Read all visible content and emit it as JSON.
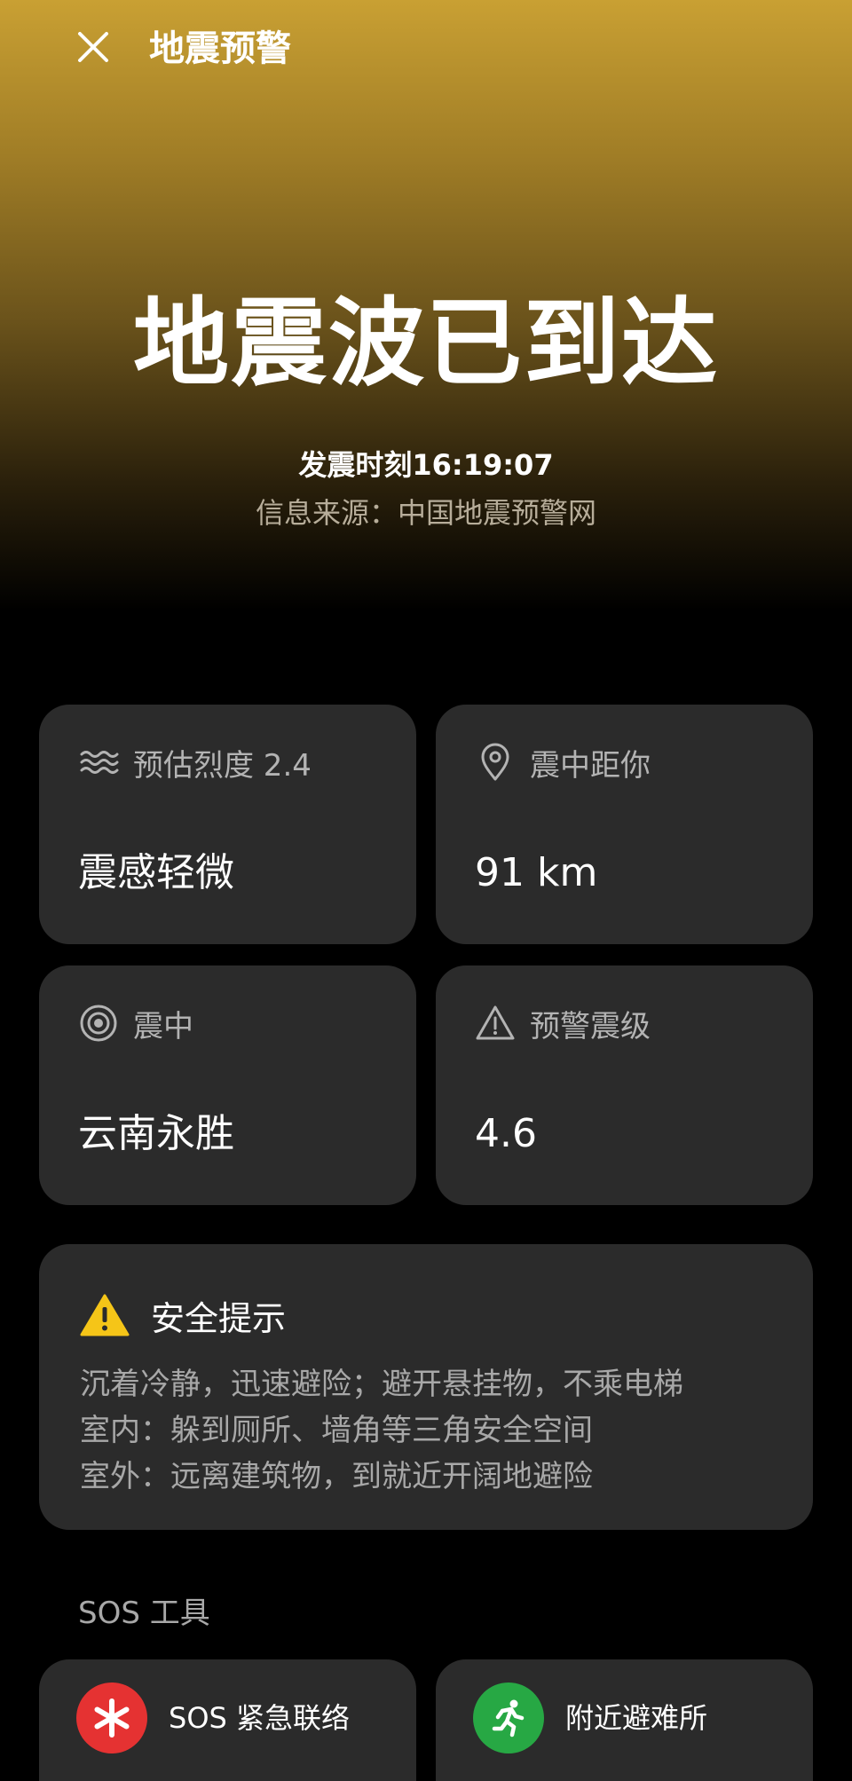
{
  "header": {
    "title": "地震预警",
    "close_icon": "close-icon"
  },
  "alert": {
    "headline": "地震波已到达",
    "quake_time": "发震时刻16:19:07",
    "source": "信息来源：中国地震预警网"
  },
  "cards": [
    {
      "icon": "wave-icon",
      "label": "预估烈度 2.4",
      "value": "震感轻微"
    },
    {
      "icon": "location-pin-icon",
      "label": "震中距你",
      "value": "91 km"
    },
    {
      "icon": "target-icon",
      "label": "震中",
      "value": "云南永胜"
    },
    {
      "icon": "warning-outline-icon",
      "label": "预警震级",
      "value": "4.6"
    }
  ],
  "safety": {
    "icon": "warning-filled-icon",
    "title": "安全提示",
    "tips": [
      "沉着冷静，迅速避险；避开悬挂物，不乘电梯",
      "室内：躲到厕所、墙角等三角安全空间",
      "室外：远离建筑物，到就近开阔地避险"
    ]
  },
  "sos": {
    "heading": "SOS 工具",
    "tools": [
      {
        "icon": "asterisk-icon",
        "label": "SOS 紧急联络",
        "color": "#e53232"
      },
      {
        "icon": "running-person-icon",
        "label": "附近避难所",
        "color": "#27a844"
      }
    ]
  },
  "colors": {
    "hero_top": "#c9a033",
    "background": "#000000",
    "card": "#2b2b2b",
    "warning_yellow": "#f5c518"
  }
}
